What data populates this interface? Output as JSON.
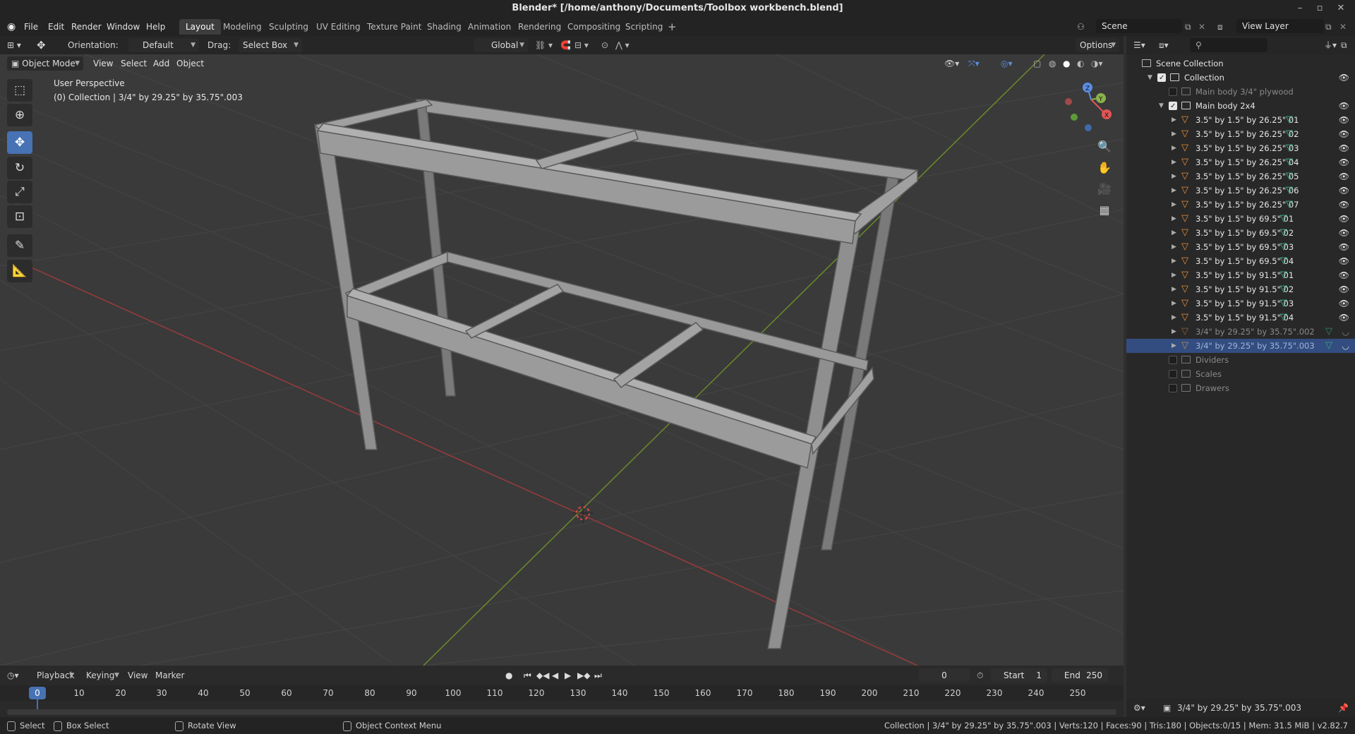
{
  "window": {
    "title": "Blender* [/home/anthony/Documents/Toolbox workbench.blend]"
  },
  "menus": [
    "File",
    "Edit",
    "Render",
    "Window",
    "Help"
  ],
  "workspace_tabs": [
    "Layout",
    "Modeling",
    "Sculpting",
    "UV Editing",
    "Texture Paint",
    "Shading",
    "Animation",
    "Rendering",
    "Compositing",
    "Scripting"
  ],
  "active_workspace": "Layout",
  "scene": {
    "name": "Scene",
    "view_layer": "View Layer"
  },
  "tool_header": {
    "orientation_label": "Orientation:",
    "orientation_value": "Default",
    "drag_label": "Drag:",
    "drag_value": "Select Box",
    "transform_orientation": "Global",
    "options_label": "Options"
  },
  "view_header": {
    "mode": "Object Mode",
    "items": [
      "View",
      "Select",
      "Add",
      "Object"
    ]
  },
  "viewport": {
    "perspective_text": "User Perspective",
    "collection_text": "(0) Collection | 3/4\" by 29.25\" by 35.75\".003"
  },
  "outliner": {
    "root": "Scene Collection",
    "collection": "Collection",
    "plywood": "Main body 3/4\" plywood",
    "main_body": "Main body 2x4",
    "objects": [
      "3.5\" by 1.5\" by 26.25\" 01",
      "3.5\" by 1.5\" by 26.25\" 02",
      "3.5\" by 1.5\" by 26.25\" 03",
      "3.5\" by 1.5\" by 26.25\" 04",
      "3.5\" by 1.5\" by 26.25\" 05",
      "3.5\" by 1.5\" by 26.25\" 06",
      "3.5\" by 1.5\" by 26.25\" 07",
      "3.5\" by 1.5\" by 69.5\" 01",
      "3.5\" by 1.5\" by 69.5\" 02",
      "3.5\" by 1.5\" by 69.5\" 03",
      "3.5\" by 1.5\" by 69.5\" 04",
      "3.5\" by 1.5\" by 91.5\" 01",
      "3.5\" by 1.5\" by 91.5\" 02",
      "3.5\" by 1.5\" by 91.5\" 03",
      "3.5\" by 1.5\" by 91.5\" 04"
    ],
    "hidden_objects": [
      "3/4\" by 29.25\" by 35.75\".002",
      "3/4\" by 29.25\" by 35.75\".003"
    ],
    "other_collections": [
      "Dividers",
      "Scales",
      "Drawers"
    ]
  },
  "properties": {
    "active_object": "3/4\" by 29.25\" by 35.75\".003"
  },
  "timeline": {
    "menus": [
      "Playback",
      "Keying",
      "View",
      "Marker"
    ],
    "current_frame": "0",
    "start_label": "Start",
    "start": "1",
    "end_label": "End",
    "end": "250",
    "ticks": [
      "0",
      "10",
      "20",
      "30",
      "40",
      "50",
      "60",
      "70",
      "80",
      "90",
      "100",
      "110",
      "120",
      "130",
      "140",
      "150",
      "160",
      "170",
      "180",
      "190",
      "200",
      "210",
      "220",
      "230",
      "240",
      "250"
    ]
  },
  "statusbar": {
    "select": "Select",
    "box_select": "Box Select",
    "rotate_view": "Rotate View",
    "context_menu": "Object Context Menu",
    "stats": "Collection | 3/4\" by 29.25\" by 35.75\".003 | Verts:120 | Faces:90 | Tris:180 | Objects:0/15 | Mem: 31.5 MiB | v2.82.7"
  },
  "colors": {
    "accent": "#4772b3",
    "selected_row": "#334d80",
    "mesh_icon": "#e98d36",
    "filter_icon": "#3ecf9a"
  }
}
